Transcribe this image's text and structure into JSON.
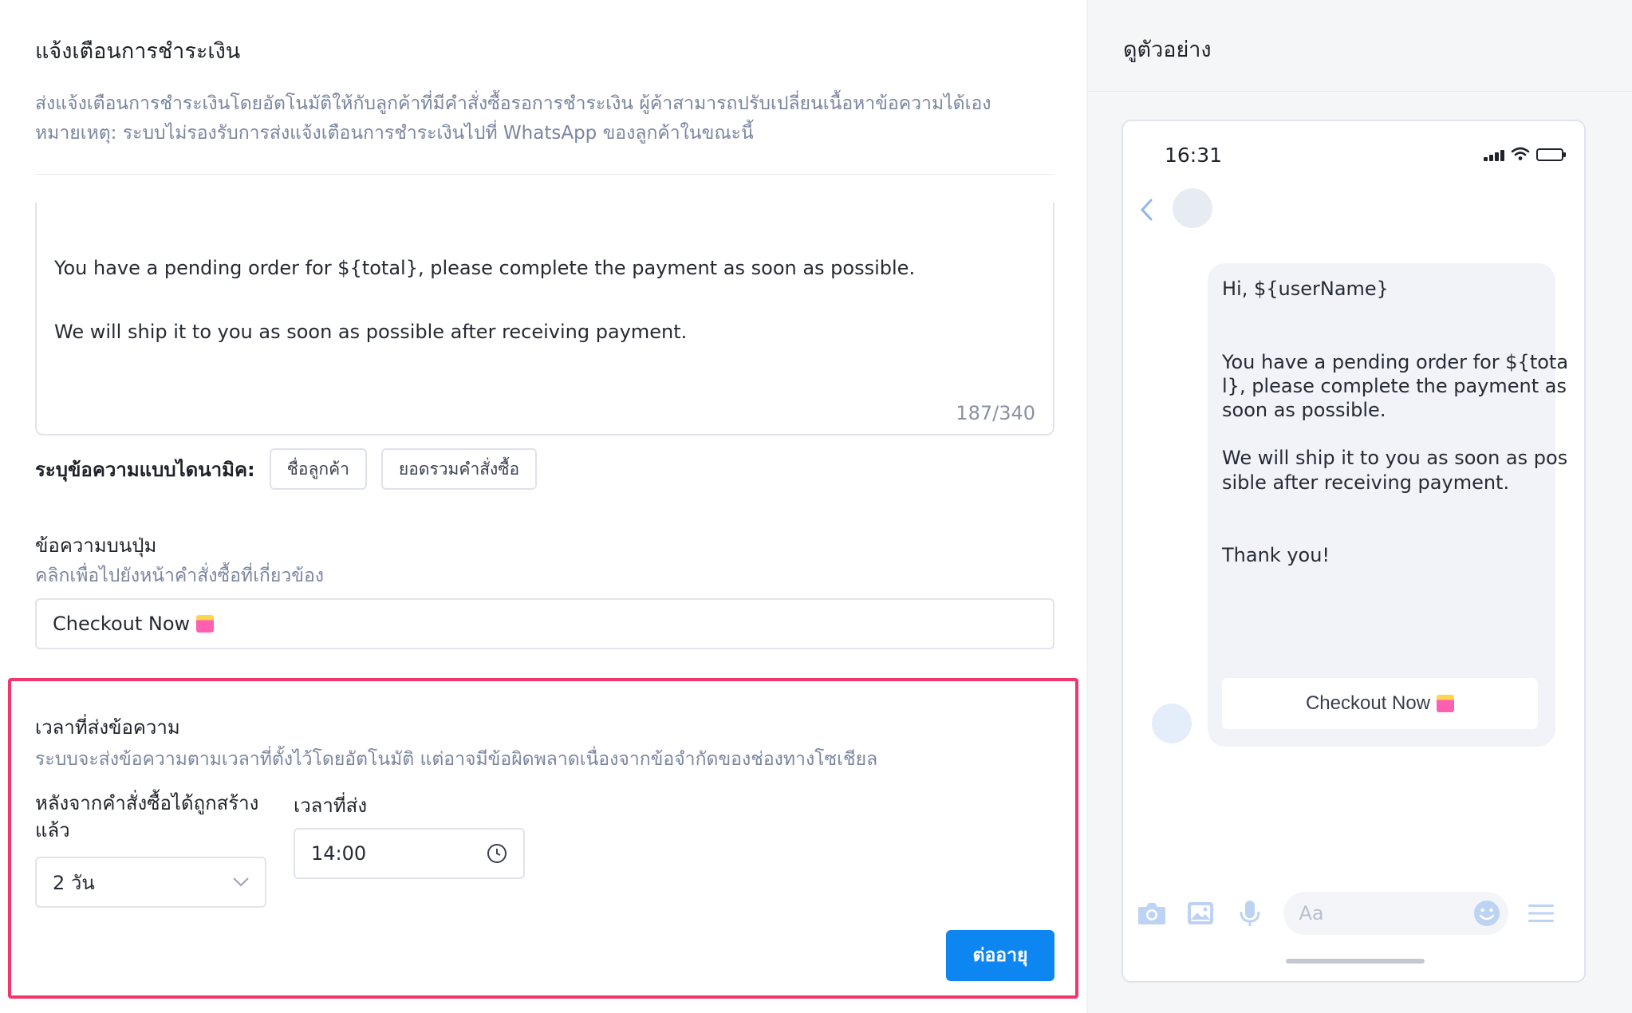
{
  "main": {
    "title": "แจ้งเตือนการชำระเงิน",
    "description_line1": "ส่งแจ้งเตือนการชำระเงินโดยอัตโนมัติให้กับลูกค้าที่มีคำสั่งซื้อรอการชำระเงิน ผู้ค้าสามารถปรับเปลี่ยนเนื้อหาข้อความได้เอง",
    "description_line2": "หมายเหตุ: ระบบไม่รองรับการส่งแจ้งเตือนการชำระเงินไปที่ WhatsApp ของลูกค้าในขณะนี้"
  },
  "message_editor": {
    "line1": "You have a pending order for ${total}, please complete the payment as soon as possible.",
    "line2": "We will ship it to you as soon as possible after receiving payment.",
    "counter": "187/340"
  },
  "dynamic": {
    "label": "ระบุข้อความแบบไดนามิค:",
    "chips": [
      "ชื่อลูกค้า",
      "ยอดรวมคำสั่งซื้อ"
    ]
  },
  "button_text": {
    "title": "ข้อความบนปุ่ม",
    "subtitle": "คลิกเพื่อไปยังหน้าคำสั่งซื้อที่เกี่ยวข้อง",
    "value": "Checkout Now"
  },
  "send_time": {
    "title": "เวลาที่ส่งข้อความ",
    "subtitle": "ระบบจะส่งข้อความตามเวลาที่ตั้งไว้โดยอัตโนมัติ แต่อาจมีข้อผิดพลาดเนื่องจากข้อจำกัดของช่องทางโซเชียล",
    "after_label": "หลังจากคำสั่งซื้อได้ถูกสร้างแล้ว",
    "after_value": "2 วัน",
    "time_label": "เวลาที่ส่ง",
    "time_value": "14:00",
    "continue_label": "ต่ออายุ"
  },
  "preview": {
    "title": "ดูตัวอย่าง",
    "clock": "16:31",
    "bubble_lines": [
      "Hi, ${userName}",
      "You have a pending order for ${tota",
      "l}, please complete the payment as",
      "soon as possible.",
      "We will ship it to you as soon as pos",
      "sible after receiving payment.",
      "Thank you!"
    ],
    "button": "Checkout Now",
    "input_placeholder": "Aa"
  },
  "colors": {
    "accent": "#0e86f2",
    "highlight": "#f0366c",
    "muted_text": "#7b85a0"
  }
}
